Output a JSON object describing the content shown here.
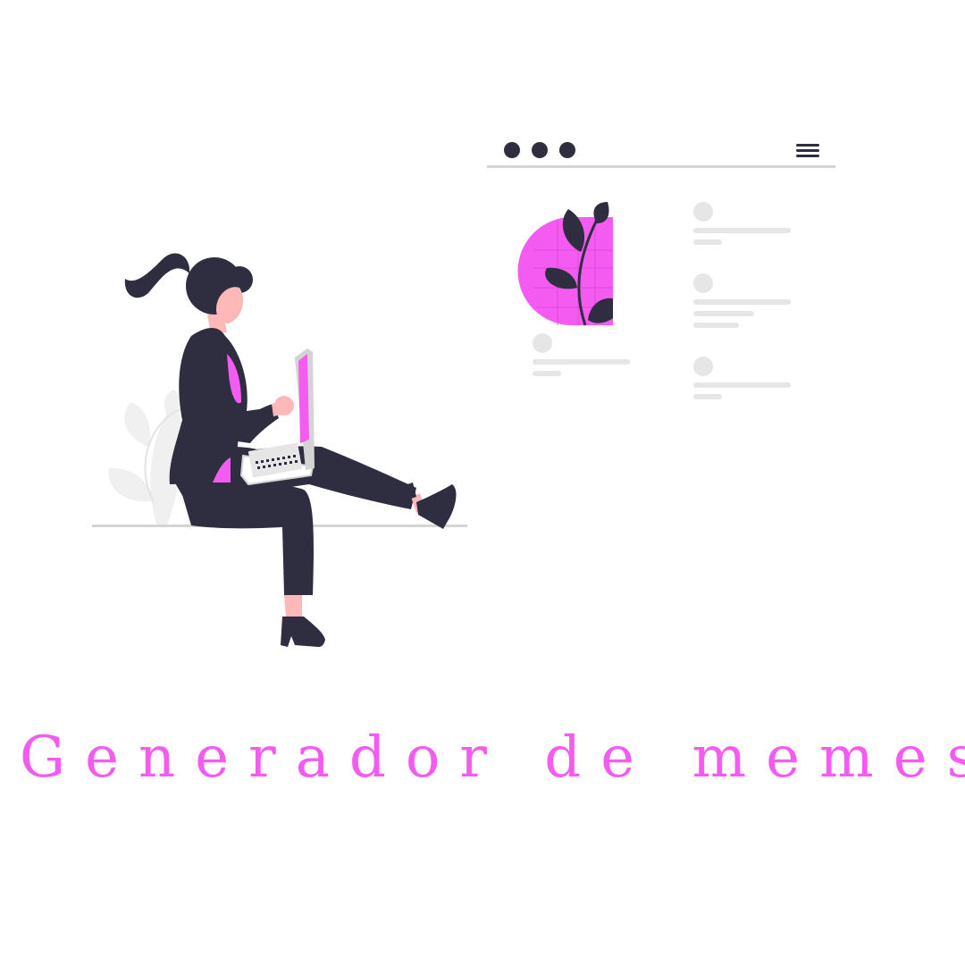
{
  "title": "Generador de memes",
  "colors": {
    "accent": "#f45bf0",
    "dark": "#2f2e41",
    "skin": "#ffb8b8",
    "placeholder": "#e6e6e6",
    "line": "#d4d4d4",
    "background": "#ffffff"
  },
  "icons": {
    "window_dots": "three-dots-icon",
    "menu": "hamburger-menu-icon"
  }
}
